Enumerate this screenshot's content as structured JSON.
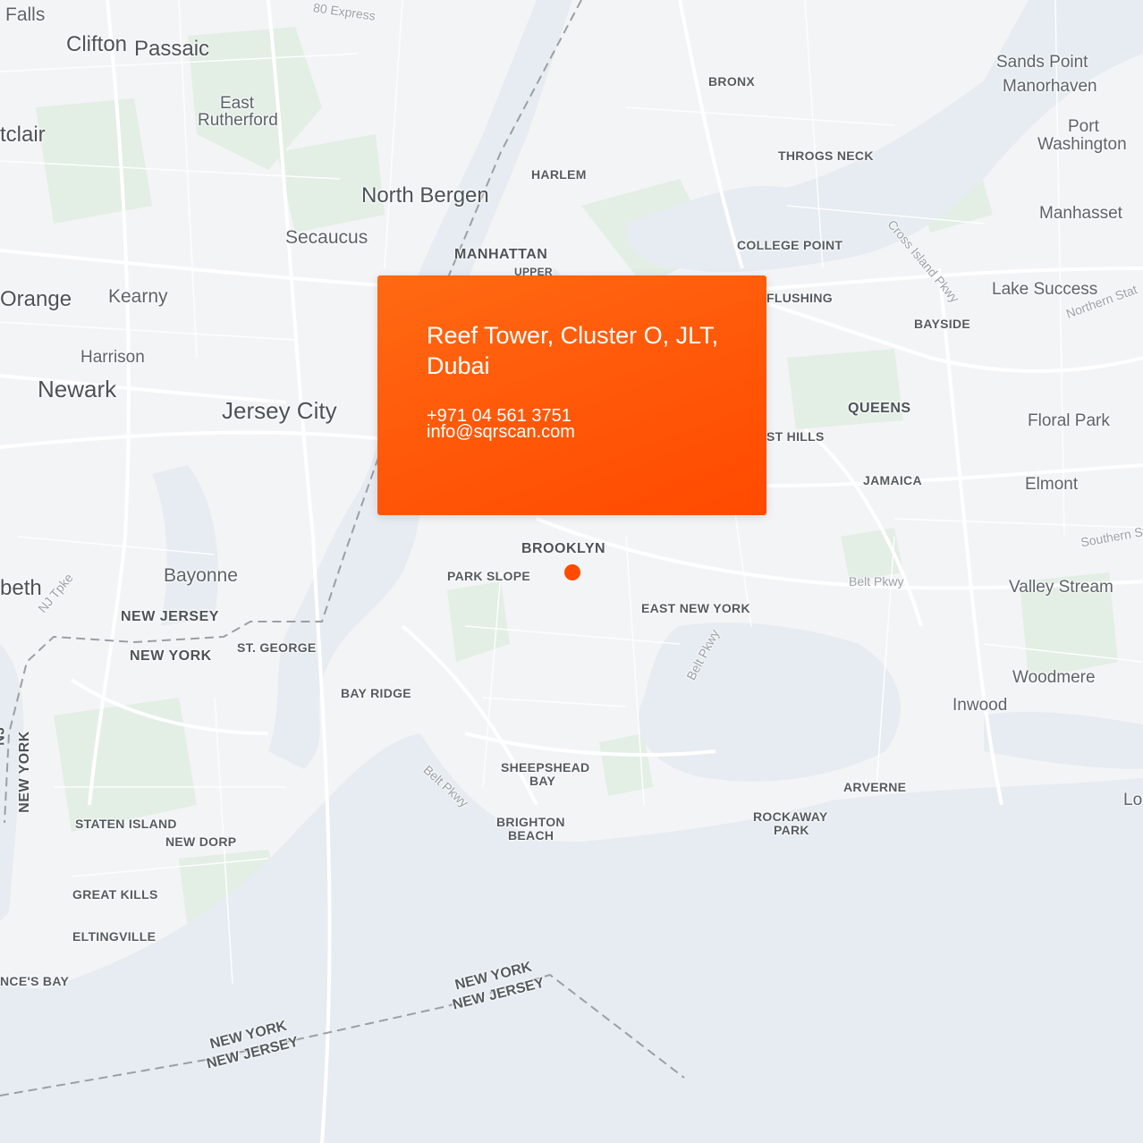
{
  "map": {
    "colors": {
      "land": "#f3f4f6",
      "water": "#e6ecf1",
      "park": "#e3eee5",
      "road": "#ffffff",
      "accent": "#ff4a00"
    },
    "labels": {
      "falls": "Falls",
      "clifton": "Clifton",
      "passaic": "Passaic",
      "express": "80 Express",
      "east_rutherford_1": "East",
      "east_rutherford_2": "Rutherford",
      "montclair": "tclair",
      "north_bergen": "North Bergen",
      "secaucus": "Secaucus",
      "orange": "Orange",
      "kearny": "Kearny",
      "harrison": "Harrison",
      "newark": "Newark",
      "jersey_city": "Jersey City",
      "bayonne": "Bayonne",
      "elizabeth": "beth",
      "nj_tpke": "NJ Tpke",
      "new_jersey_1": "NEW JERSEY",
      "new_york_1": "NEW YORK",
      "st_george": "ST. GEORGE",
      "new_york_vertical": "NEW YORK",
      "nj_vertical": "NJ",
      "staten_island": "STATEN ISLAND",
      "new_dorp": "NEW DORP",
      "great_kills": "GREAT KILLS",
      "eltingville": "ELTINGVILLE",
      "princes_bay": "NCE'S BAY",
      "bronx": "BRONX",
      "harlem": "HARLEM",
      "manhattan": "MANHATTAN",
      "upper": "UPPER",
      "throgs_neck": "THROGS NECK",
      "college_point": "COLLEGE POINT",
      "cross_island": "Cross Island Pkwy",
      "flushing": "FLUSHING",
      "bayside": "BAYSIDE",
      "queens": "QUEENS",
      "forest_hills": "ST HILLS",
      "jamaica": "JAMAICA",
      "sands_point": "Sands Point",
      "manorhaven": "Manorhaven",
      "port_washington_1": "Port",
      "port_washington_2": "Washington",
      "manhasset": "Manhasset",
      "lake_success": "Lake Success",
      "northern_state": "Northern Stat",
      "floral_park": "Floral Park",
      "elmont": "Elmont",
      "southern_state": "Southern St",
      "valley_stream": "Valley Stream",
      "belt_pkwy_1": "Belt Pkwy",
      "belt_pkwy_2": "Belt Pkwy",
      "belt_pkwy_3": "Belt Pkwy",
      "woodmere": "Woodmere",
      "inwood": "Inwood",
      "brooklyn": "BROOKLYN",
      "park_slope": "PARK SLOPE",
      "east_new_york": "EAST NEW YORK",
      "bay_ridge": "BAY RIDGE",
      "sheepshead_1": "SHEEPSHEAD",
      "sheepshead_2": "BAY",
      "brighton_1": "BRIGHTON",
      "brighton_2": "BEACH",
      "arverne": "ARVERNE",
      "rockaway_1": "ROCKAWAY",
      "rockaway_2": "PARK",
      "long_beach": "Lo",
      "ny_border_1a": "NEW YORK",
      "nj_border_1b": "NEW JERSEY",
      "ny_border_2a": "NEW YORK",
      "nj_border_2b": "NEW JERSEY"
    }
  },
  "card": {
    "address": "Reef Tower, Cluster O, JLT, Dubai",
    "phone": "+971 04 561 3751",
    "email": "info@sqrscan.com"
  },
  "marker": {
    "icon": "location-dot-icon"
  }
}
